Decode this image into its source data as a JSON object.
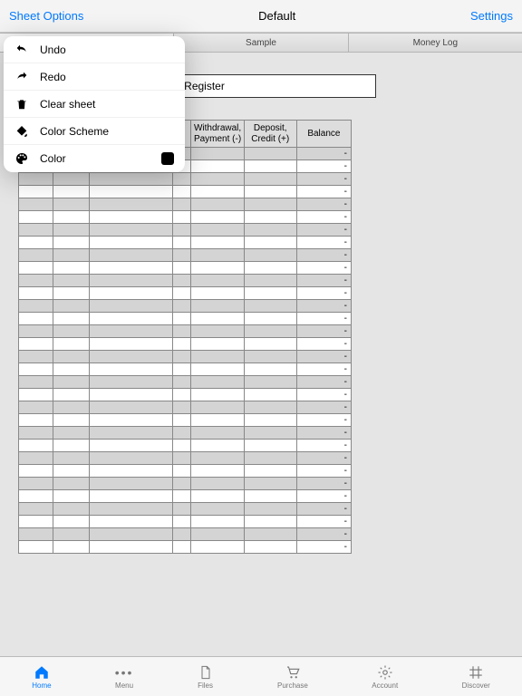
{
  "header": {
    "left": "Sheet Options",
    "title": "Default",
    "right": "Settings"
  },
  "tabs": [
    "",
    "Sample",
    "Money Log"
  ],
  "register": {
    "title": "ok Register",
    "columns": {
      "num": "",
      "date": "",
      "desc": "",
      "r": "R",
      "wd": "Withdrawal, Payment (-)",
      "dep": "Deposit, Credit (+)",
      "bal": "Balance"
    },
    "rows": [
      {
        "bal": "-"
      },
      {
        "bal": "-"
      },
      {
        "bal": "-"
      },
      {
        "bal": "-"
      },
      {
        "bal": "-"
      },
      {
        "bal": "-"
      },
      {
        "bal": "-"
      },
      {
        "bal": "-"
      },
      {
        "bal": "-"
      },
      {
        "bal": "-"
      },
      {
        "bal": "-"
      },
      {
        "bal": "-"
      },
      {
        "bal": "-"
      },
      {
        "bal": "-"
      },
      {
        "bal": "-"
      },
      {
        "bal": "-"
      },
      {
        "bal": "-"
      },
      {
        "bal": "-"
      },
      {
        "bal": "-"
      },
      {
        "bal": "-"
      },
      {
        "bal": "-"
      },
      {
        "bal": "-"
      },
      {
        "bal": "-"
      },
      {
        "bal": "-"
      },
      {
        "bal": "-"
      },
      {
        "bal": "-"
      },
      {
        "bal": "-"
      },
      {
        "bal": "-"
      },
      {
        "bal": "-"
      },
      {
        "bal": "-"
      },
      {
        "bal": "-"
      },
      {
        "bal": "-"
      }
    ]
  },
  "popover": {
    "undo": "Undo",
    "redo": "Redo",
    "clear": "Clear sheet",
    "scheme": "Color Scheme",
    "color": "Color"
  },
  "bottom": {
    "home": "Home",
    "menu": "Menu",
    "files": "Files",
    "purchase": "Purchase",
    "account": "Account",
    "discover": "Discover"
  }
}
